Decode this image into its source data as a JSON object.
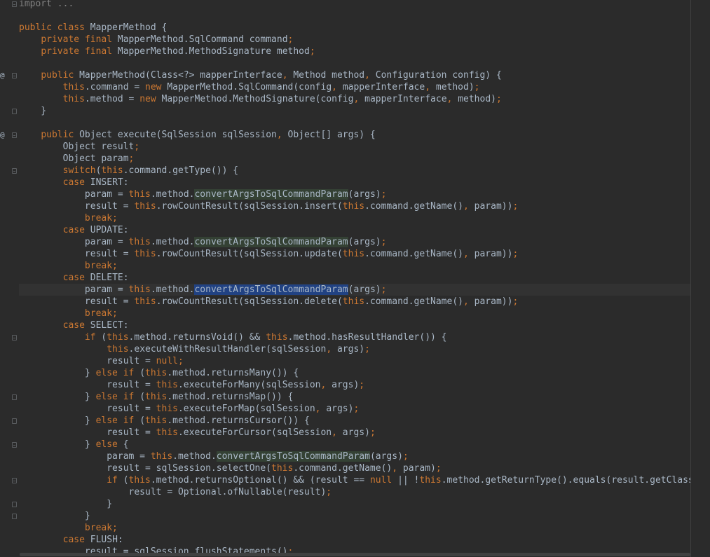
{
  "editor": {
    "colors": {
      "background": "#2b2b2b",
      "keyword": "#cc7832",
      "text": "#a9b7c6",
      "comment": "#808080",
      "usage_highlight": "#344134",
      "selection": "#214283",
      "current_line": "#323232"
    },
    "gutter_markers": [
      "@",
      "@"
    ],
    "lines": [
      [
        [
          "cm",
          "import ..."
        ]
      ],
      [],
      [
        [
          "kw",
          "public class "
        ],
        [
          "id",
          "MapperMethod {"
        ]
      ],
      [
        [
          "id",
          "    "
        ],
        [
          "kw",
          "private final "
        ],
        [
          "id",
          "MapperMethod.SqlCommand command"
        ],
        [
          "pn",
          ";"
        ]
      ],
      [
        [
          "id",
          "    "
        ],
        [
          "kw",
          "private final "
        ],
        [
          "id",
          "MapperMethod.MethodSignature method"
        ],
        [
          "pn",
          ";"
        ]
      ],
      [],
      [
        [
          "id",
          "    "
        ],
        [
          "kw",
          "public "
        ],
        [
          "id",
          "MapperMethod(Class<?> mapperInterface"
        ],
        [
          "pn",
          ", "
        ],
        [
          "id",
          "Method method"
        ],
        [
          "pn",
          ", "
        ],
        [
          "id",
          "Configuration config) {"
        ]
      ],
      [
        [
          "id",
          "        "
        ],
        [
          "kw",
          "this"
        ],
        [
          "id",
          ".command = "
        ],
        [
          "kw",
          "new "
        ],
        [
          "id",
          "MapperMethod.SqlCommand(config"
        ],
        [
          "pn",
          ", "
        ],
        [
          "id",
          "mapperInterface"
        ],
        [
          "pn",
          ", "
        ],
        [
          "id",
          "method)"
        ],
        [
          "pn",
          ";"
        ]
      ],
      [
        [
          "id",
          "        "
        ],
        [
          "kw",
          "this"
        ],
        [
          "id",
          ".method = "
        ],
        [
          "kw",
          "new "
        ],
        [
          "id",
          "MapperMethod.MethodSignature(config"
        ],
        [
          "pn",
          ", "
        ],
        [
          "id",
          "mapperInterface"
        ],
        [
          "pn",
          ", "
        ],
        [
          "id",
          "method)"
        ],
        [
          "pn",
          ";"
        ]
      ],
      [
        [
          "id",
          "    }"
        ]
      ],
      [],
      [
        [
          "id",
          "    "
        ],
        [
          "kw",
          "public "
        ],
        [
          "id",
          "Object execute(SqlSession sqlSession"
        ],
        [
          "pn",
          ", "
        ],
        [
          "id",
          "Object[] args) {"
        ]
      ],
      [
        [
          "id",
          "        Object result"
        ],
        [
          "pn",
          ";"
        ]
      ],
      [
        [
          "id",
          "        Object param"
        ],
        [
          "pn",
          ";"
        ]
      ],
      [
        [
          "id",
          "        "
        ],
        [
          "kw",
          "switch"
        ],
        [
          "id",
          "("
        ],
        [
          "kw",
          "this"
        ],
        [
          "id",
          ".command.getType()) {"
        ]
      ],
      [
        [
          "id",
          "        "
        ],
        [
          "kw",
          "case "
        ],
        [
          "id",
          "INSERT:"
        ]
      ],
      [
        [
          "id",
          "            param = "
        ],
        [
          "kw",
          "this"
        ],
        [
          "id",
          ".method."
        ],
        [
          "hl",
          "convertArgsToSqlCommandParam"
        ],
        [
          "id",
          "(args)"
        ],
        [
          "pn",
          ";"
        ]
      ],
      [
        [
          "id",
          "            result = "
        ],
        [
          "kw",
          "this"
        ],
        [
          "id",
          ".rowCountResult(sqlSession.insert("
        ],
        [
          "kw",
          "this"
        ],
        [
          "id",
          ".command.getName()"
        ],
        [
          "pn",
          ", "
        ],
        [
          "id",
          "param))"
        ],
        [
          "pn",
          ";"
        ]
      ],
      [
        [
          "id",
          "            "
        ],
        [
          "kw",
          "break;"
        ]
      ],
      [
        [
          "id",
          "        "
        ],
        [
          "kw",
          "case "
        ],
        [
          "id",
          "UPDATE:"
        ]
      ],
      [
        [
          "id",
          "            param = "
        ],
        [
          "kw",
          "this"
        ],
        [
          "id",
          ".method."
        ],
        [
          "hl",
          "convertArgsToSqlCommandParam"
        ],
        [
          "id",
          "(args)"
        ],
        [
          "pn",
          ";"
        ]
      ],
      [
        [
          "id",
          "            result = "
        ],
        [
          "kw",
          "this"
        ],
        [
          "id",
          ".rowCountResult(sqlSession.update("
        ],
        [
          "kw",
          "this"
        ],
        [
          "id",
          ".command.getName()"
        ],
        [
          "pn",
          ", "
        ],
        [
          "id",
          "param))"
        ],
        [
          "pn",
          ";"
        ]
      ],
      [
        [
          "id",
          "            "
        ],
        [
          "kw",
          "break;"
        ]
      ],
      [
        [
          "id",
          "        "
        ],
        [
          "kw",
          "case "
        ],
        [
          "id",
          "DELETE:"
        ]
      ],
      [
        [
          "id",
          "            param = "
        ],
        [
          "kw",
          "this"
        ],
        [
          "id",
          ".method."
        ],
        [
          "sel",
          "convertArgsToSqlCommandParam"
        ],
        [
          "id",
          "(args)"
        ],
        [
          "pn",
          ";"
        ]
      ],
      [
        [
          "id",
          "            result = "
        ],
        [
          "kw",
          "this"
        ],
        [
          "id",
          ".rowCountResult(sqlSession.delete("
        ],
        [
          "kw",
          "this"
        ],
        [
          "id",
          ".command.getName()"
        ],
        [
          "pn",
          ", "
        ],
        [
          "id",
          "param))"
        ],
        [
          "pn",
          ";"
        ]
      ],
      [
        [
          "id",
          "            "
        ],
        [
          "kw",
          "break;"
        ]
      ],
      [
        [
          "id",
          "        "
        ],
        [
          "kw",
          "case "
        ],
        [
          "id",
          "SELECT:"
        ]
      ],
      [
        [
          "id",
          "            "
        ],
        [
          "kw",
          "if "
        ],
        [
          "id",
          "("
        ],
        [
          "kw",
          "this"
        ],
        [
          "id",
          ".method.returnsVoid() && "
        ],
        [
          "kw",
          "this"
        ],
        [
          "id",
          ".method.hasResultHandler()) {"
        ]
      ],
      [
        [
          "id",
          "                "
        ],
        [
          "kw",
          "this"
        ],
        [
          "id",
          ".executeWithResultHandler(sqlSession"
        ],
        [
          "pn",
          ", "
        ],
        [
          "id",
          "args)"
        ],
        [
          "pn",
          ";"
        ]
      ],
      [
        [
          "id",
          "                result = "
        ],
        [
          "kw",
          "null;"
        ]
      ],
      [
        [
          "id",
          "            } "
        ],
        [
          "kw",
          "else if "
        ],
        [
          "id",
          "("
        ],
        [
          "kw",
          "this"
        ],
        [
          "id",
          ".method.returnsMany()) {"
        ]
      ],
      [
        [
          "id",
          "                result = "
        ],
        [
          "kw",
          "this"
        ],
        [
          "id",
          ".executeForMany(sqlSession"
        ],
        [
          "pn",
          ", "
        ],
        [
          "id",
          "args)"
        ],
        [
          "pn",
          ";"
        ]
      ],
      [
        [
          "id",
          "            } "
        ],
        [
          "kw",
          "else if "
        ],
        [
          "id",
          "("
        ],
        [
          "kw",
          "this"
        ],
        [
          "id",
          ".method.returnsMap()) {"
        ]
      ],
      [
        [
          "id",
          "                result = "
        ],
        [
          "kw",
          "this"
        ],
        [
          "id",
          ".executeForMap(sqlSession"
        ],
        [
          "pn",
          ", "
        ],
        [
          "id",
          "args)"
        ],
        [
          "pn",
          ";"
        ]
      ],
      [
        [
          "id",
          "            } "
        ],
        [
          "kw",
          "else if "
        ],
        [
          "id",
          "("
        ],
        [
          "kw",
          "this"
        ],
        [
          "id",
          ".method.returnsCursor()) {"
        ]
      ],
      [
        [
          "id",
          "                result = "
        ],
        [
          "kw",
          "this"
        ],
        [
          "id",
          ".executeForCursor(sqlSession"
        ],
        [
          "pn",
          ", "
        ],
        [
          "id",
          "args)"
        ],
        [
          "pn",
          ";"
        ]
      ],
      [
        [
          "id",
          "            } "
        ],
        [
          "kw",
          "else "
        ],
        [
          "id",
          "{"
        ]
      ],
      [
        [
          "id",
          "                param = "
        ],
        [
          "kw",
          "this"
        ],
        [
          "id",
          ".method."
        ],
        [
          "hl",
          "convertArgsToSqlCommandParam"
        ],
        [
          "id",
          "(args)"
        ],
        [
          "pn",
          ";"
        ]
      ],
      [
        [
          "id",
          "                result = sqlSession.selectOne("
        ],
        [
          "kw",
          "this"
        ],
        [
          "id",
          ".command.getName()"
        ],
        [
          "pn",
          ", "
        ],
        [
          "id",
          "param)"
        ],
        [
          "pn",
          ";"
        ]
      ],
      [
        [
          "id",
          "                "
        ],
        [
          "kw",
          "if "
        ],
        [
          "id",
          "("
        ],
        [
          "kw",
          "this"
        ],
        [
          "id",
          ".method.returnsOptional() && (result == "
        ],
        [
          "kw",
          "null "
        ],
        [
          "id",
          "|| !"
        ],
        [
          "kw",
          "this"
        ],
        [
          "id",
          ".method.getReturnType().equals(result.getClass"
        ]
      ],
      [
        [
          "id",
          "                    result = Optional.ofNullable(result)"
        ],
        [
          "pn",
          ";"
        ]
      ],
      [
        [
          "id",
          "                }"
        ]
      ],
      [
        [
          "id",
          "            }"
        ]
      ],
      [
        [
          "id",
          "            "
        ],
        [
          "kw",
          "break;"
        ]
      ],
      [
        [
          "id",
          "        "
        ],
        [
          "kw",
          "case "
        ],
        [
          "id",
          "FLUSH:"
        ]
      ],
      [
        [
          "id",
          "            result = sqlSession.flushStatements()"
        ],
        [
          "pn",
          ";"
        ]
      ]
    ]
  }
}
